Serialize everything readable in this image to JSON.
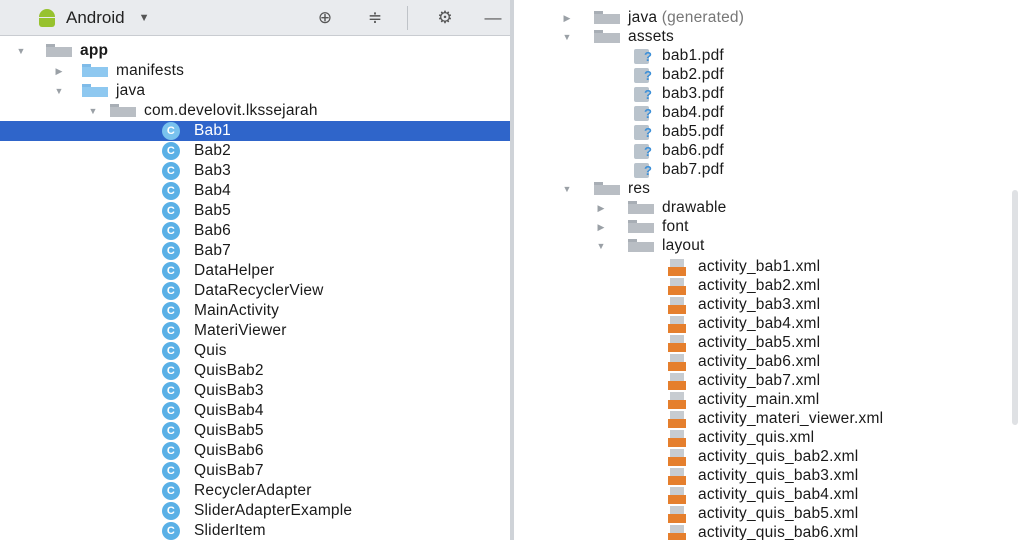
{
  "toolbar": {
    "view_label": "Android",
    "icons": [
      "android-icon",
      "dropdown-caret-icon",
      "crosshair-icon",
      "collapse-all-icon",
      "gear-icon",
      "hide-icon"
    ]
  },
  "left_tree": {
    "app": "app",
    "manifests": "manifests",
    "java": "java",
    "package": "com.develovit.lkssejarah",
    "classes": [
      "Bab1",
      "Bab2",
      "Bab3",
      "Bab4",
      "Bab5",
      "Bab6",
      "Bab7",
      "DataHelper",
      "DataRecyclerView",
      "MainActivity",
      "MateriViewer",
      "Quis",
      "QuisBab2",
      "QuisBab3",
      "QuisBab4",
      "QuisBab5",
      "QuisBab6",
      "QuisBab7",
      "RecyclerAdapter",
      "SliderAdapterExample",
      "SliderItem"
    ],
    "selected": "Bab1"
  },
  "right_tree": {
    "java_generated": "java",
    "generated_suffix": "(generated)",
    "assets": "assets",
    "pdfs": [
      "bab1.pdf",
      "bab2.pdf",
      "bab3.pdf",
      "bab4.pdf",
      "bab5.pdf",
      "bab6.pdf",
      "bab7.pdf"
    ],
    "res": "res",
    "drawable": "drawable",
    "font": "font",
    "layout": "layout",
    "layouts": [
      "activity_bab1.xml",
      "activity_bab2.xml",
      "activity_bab3.xml",
      "activity_bab4.xml",
      "activity_bab5.xml",
      "activity_bab6.xml",
      "activity_bab7.xml",
      "activity_main.xml",
      "activity_materi_viewer.xml",
      "activity_quis.xml",
      "activity_quis_bab2.xml",
      "activity_quis_bab3.xml",
      "activity_quis_bab4.xml",
      "activity_quis_bab5.xml",
      "activity_quis_bab6.xml"
    ]
  },
  "colors": {
    "selection": "#2f65ca",
    "folder": "#8ec8f0",
    "class_icon": "#5ab0e6",
    "xml_icon": "#e57f2d"
  }
}
